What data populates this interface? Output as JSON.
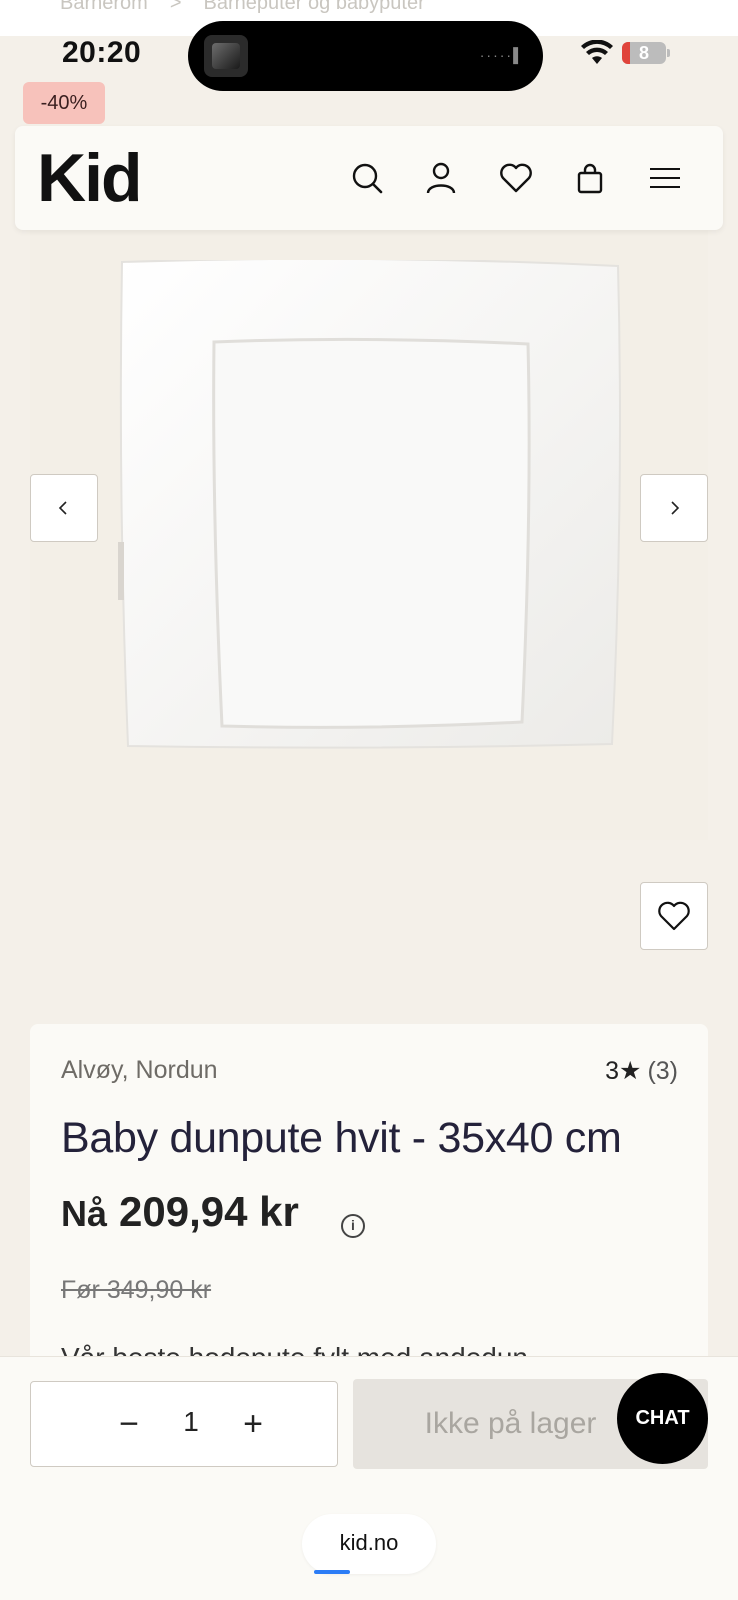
{
  "breadcrumb": {
    "items": [
      "Barnerom",
      ">",
      "Barneputer og babyputer"
    ]
  },
  "status_bar": {
    "time": "20:20",
    "battery": "8"
  },
  "badge": {
    "discount": "-40%"
  },
  "header": {
    "logo": "Kid",
    "icons": [
      "search-icon",
      "user-icon",
      "heart-icon",
      "bag-icon",
      "menu-icon"
    ]
  },
  "product": {
    "brand": "Alvøy, Nordun",
    "rating_value": "3★",
    "rating_count": "(3)",
    "title": "Baby dunpute hvit - 35x40 cm",
    "price_label": "Nå",
    "price_now": "209,94 kr",
    "price_before": "Før 349,90 kr",
    "description": "Vår beste hodepute fylt med andedun"
  },
  "buy_bar": {
    "quantity": "1",
    "minus": "−",
    "plus": "+",
    "cart_label": "Ikke på lager",
    "chat_label": "CHAT"
  },
  "browser": {
    "url": "kid.no"
  },
  "colors": {
    "badge": "#f7c2bb",
    "background": "#f4f0e9",
    "card": "#fbfaf6",
    "chat": "#000000",
    "progress": "#2b7cf6"
  }
}
